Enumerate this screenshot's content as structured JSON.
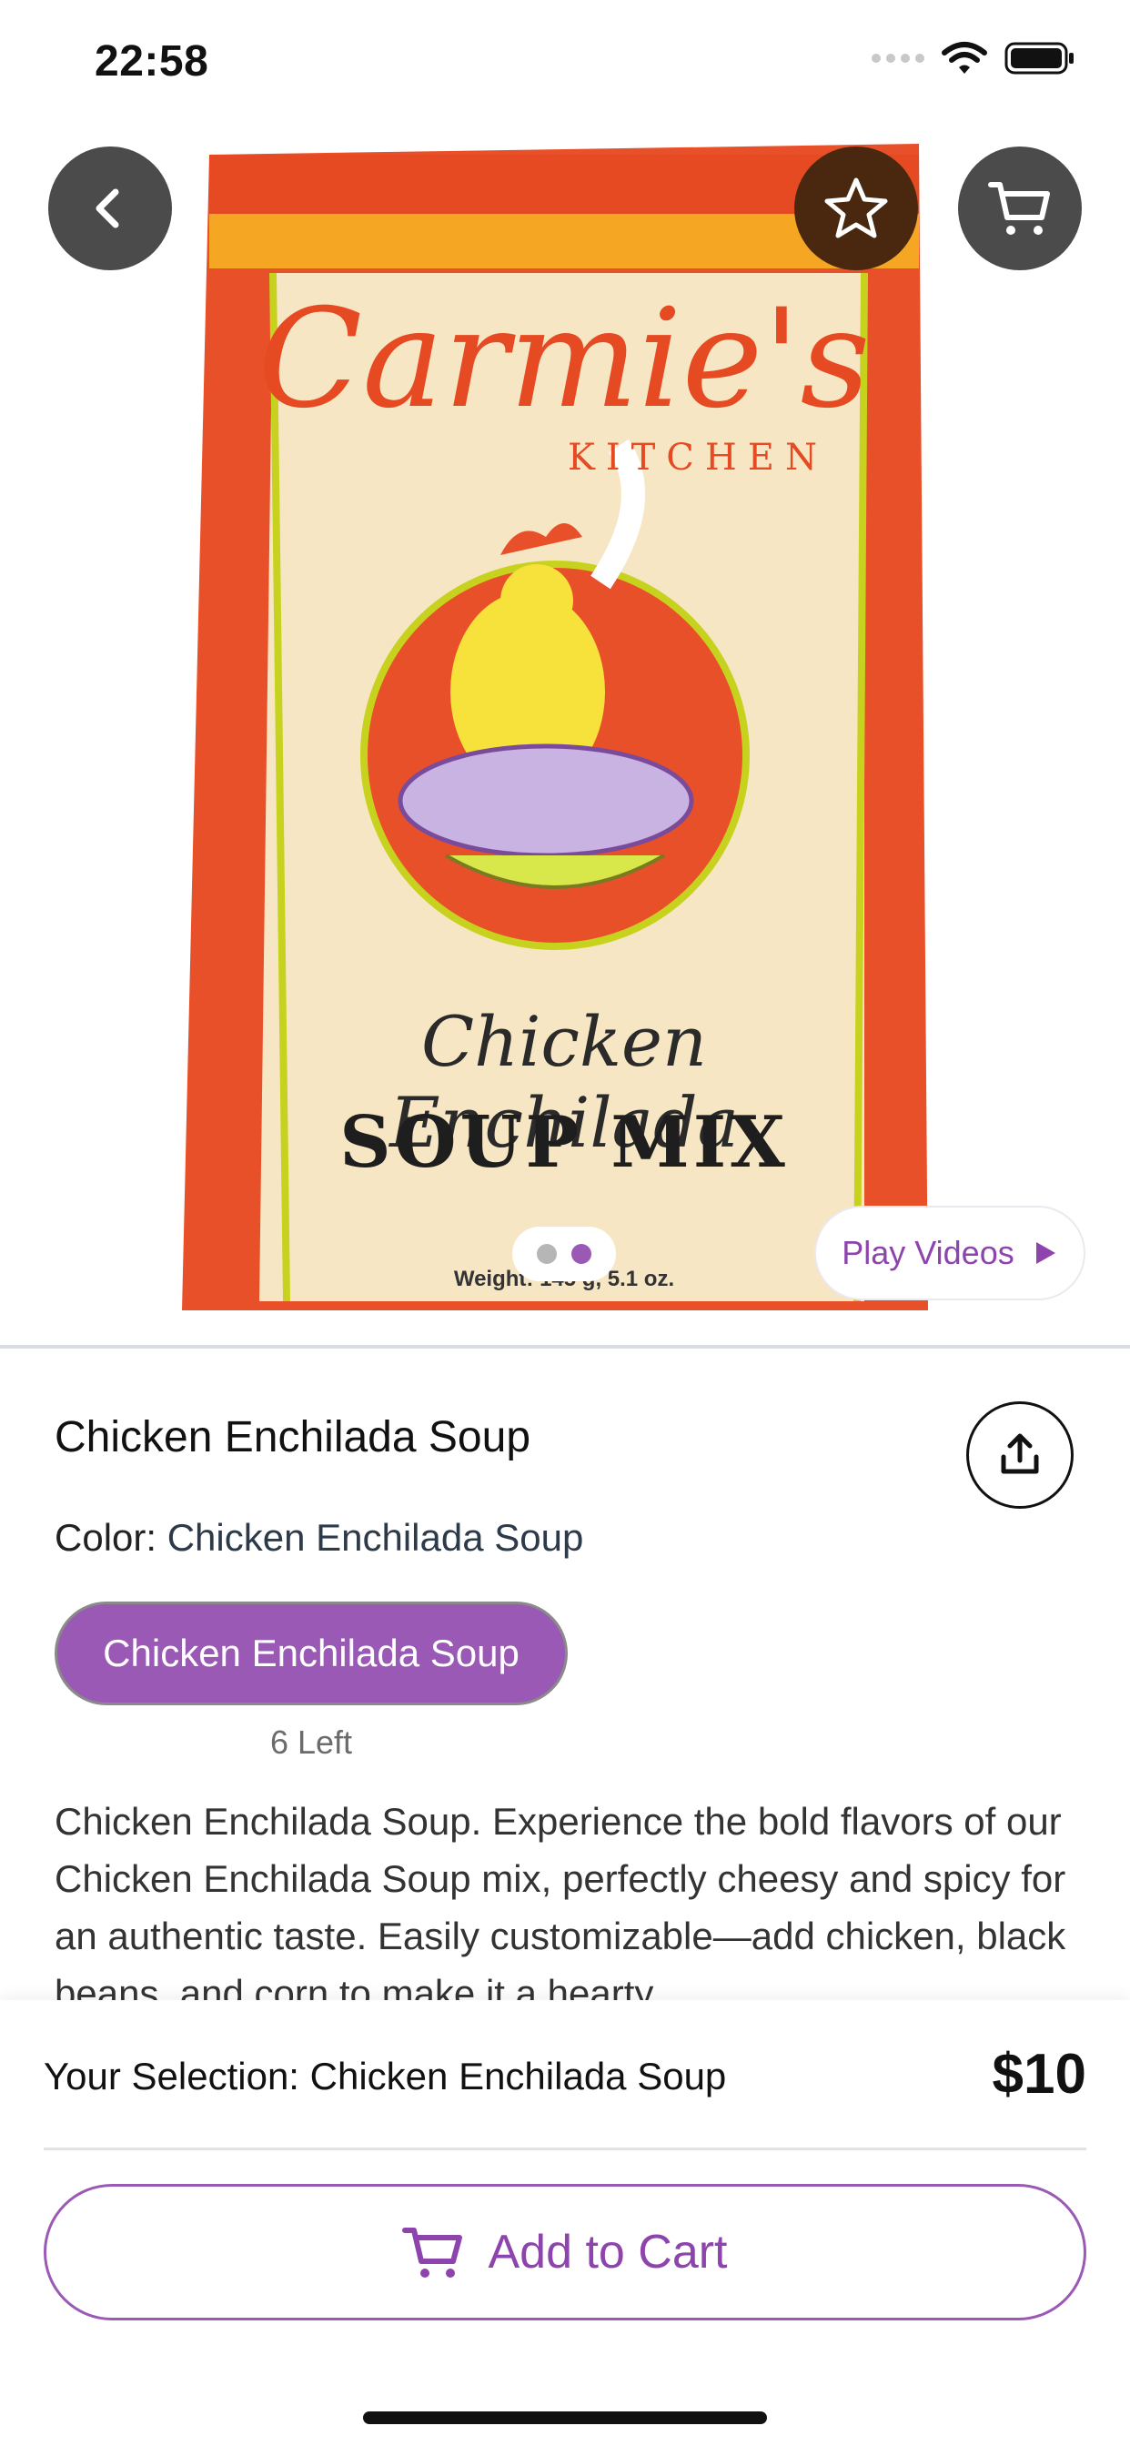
{
  "status_bar": {
    "time": "22:58"
  },
  "hero": {
    "product_image": {
      "brand": "Carmie's",
      "brand_sub": "KITCHEN",
      "flavor": "Chicken Enchilada",
      "product_type": "SOUP MIX",
      "weight": "Weight: 145 g, 5.1 oz."
    },
    "back_icon": "chevron-left-icon",
    "favorite_icon": "star-icon",
    "cart_icon": "cart-icon",
    "pager": {
      "total": 2,
      "active_index": 1
    },
    "play_videos_label": "Play Videos"
  },
  "product": {
    "title": "Chicken Enchilada Soup",
    "color_label": "Color:",
    "color_value": "Chicken Enchilada Soup",
    "variant_chip": "Chicken Enchilada Soup",
    "stock": "6 Left",
    "description": "Chicken Enchilada Soup. Experience the bold flavors of our Chicken Enchilada Soup mix, perfectly cheesy and spicy for an authentic taste. Easily customizable—add chicken, black beans, and corn to make it a hearty"
  },
  "bottom_bar": {
    "selection_label": "Your Selection:",
    "selection_value": "Chicken Enchilada Soup",
    "price": "$10",
    "add_to_cart": "Add to Cart"
  },
  "colors": {
    "accent": "#9b59b6",
    "accent_text": "#8e44ad",
    "fab_dark": "#4b4b4b",
    "fav_brown": "#4a2810"
  }
}
